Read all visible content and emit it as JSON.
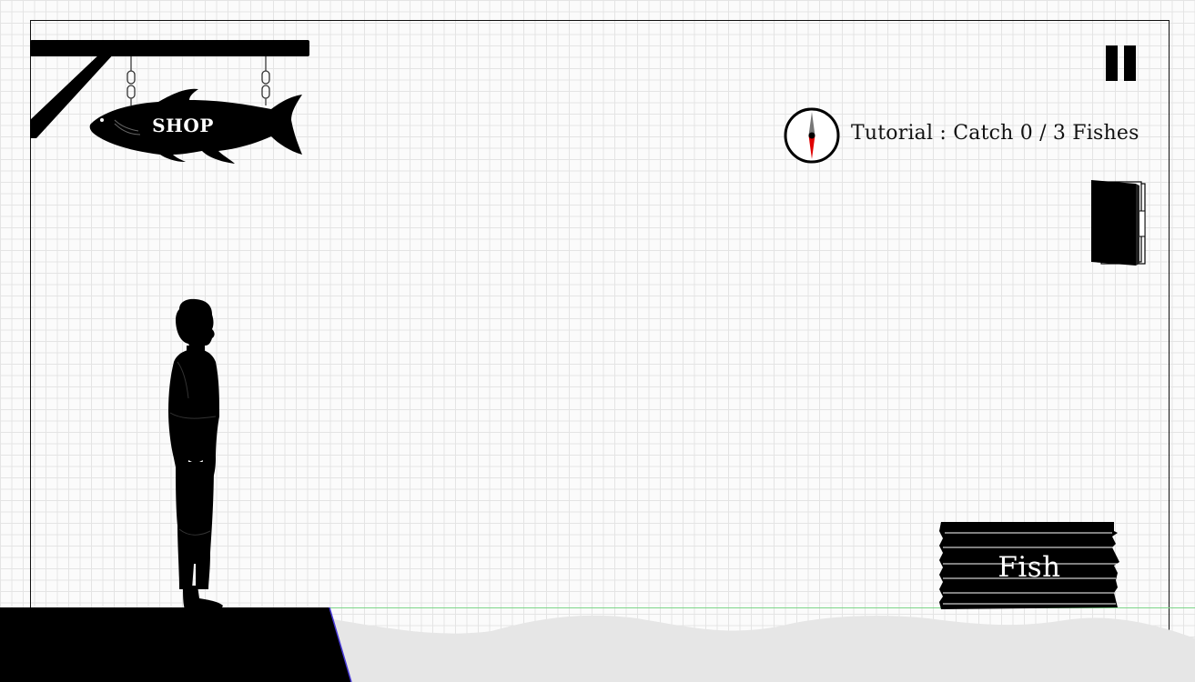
{
  "hud": {
    "shop_label": "SHOP",
    "objective_text": "Tutorial : Catch 0 / 3 Fishes",
    "fish_button_label": "Fish"
  },
  "objective": {
    "mode": "Tutorial",
    "caught": 0,
    "target": 3
  },
  "icons": {
    "pause": "pause-icon",
    "compass": "compass-icon",
    "journal": "book-icon",
    "shop": "fish-shaped-shop-sign"
  },
  "colors": {
    "silhouette": "#000000",
    "compass_needle_south": "#e00000",
    "waterline": "#7ed58a",
    "water": "#e6e6e6",
    "grid": "#e4e4e4"
  }
}
